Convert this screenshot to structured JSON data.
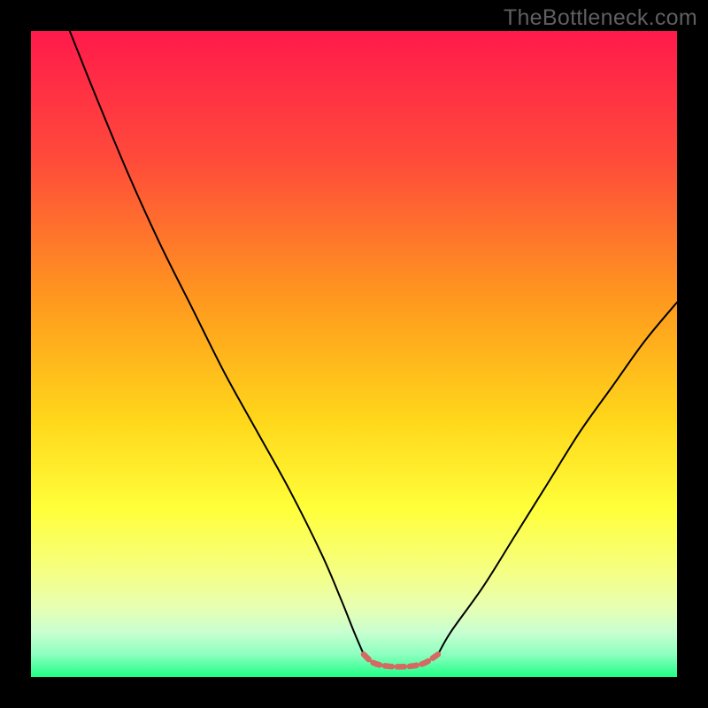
{
  "watermark": "TheBottleneck.com",
  "chart_data": {
    "type": "line",
    "title": "",
    "xlabel": "",
    "ylabel": "",
    "xlim": [
      0,
      100
    ],
    "ylim": [
      0,
      100
    ],
    "grid": false,
    "legend": false,
    "background_gradient_stops": [
      {
        "pct": 0,
        "color": "#ff1a4b"
      },
      {
        "pct": 20,
        "color": "#ff4b3a"
      },
      {
        "pct": 42,
        "color": "#ff9a1e"
      },
      {
        "pct": 60,
        "color": "#ffd61a"
      },
      {
        "pct": 74,
        "color": "#ffff3a"
      },
      {
        "pct": 83,
        "color": "#f6ff7d"
      },
      {
        "pct": 89,
        "color": "#e8ffb0"
      },
      {
        "pct": 93,
        "color": "#c9ffd0"
      },
      {
        "pct": 96.5,
        "color": "#8dffc0"
      },
      {
        "pct": 100,
        "color": "#1fff86"
      }
    ],
    "series": [
      {
        "name": "left-curve",
        "color": "#000000",
        "width": 2,
        "x": [
          6,
          10,
          15,
          20,
          25,
          30,
          35,
          40,
          45,
          48,
          50,
          51.5
        ],
        "y": [
          100,
          90,
          78,
          67,
          57,
          47,
          38,
          29,
          19,
          12,
          7,
          3.5
        ]
      },
      {
        "name": "right-curve",
        "color": "#000000",
        "width": 2,
        "x": [
          63,
          65,
          70,
          75,
          80,
          85,
          90,
          95,
          100
        ],
        "y": [
          3.5,
          7,
          14,
          22,
          30,
          38,
          45,
          52,
          58
        ]
      },
      {
        "name": "valley-highlight",
        "color": "#d56a63",
        "width": 6.5,
        "dasharray": "8 6",
        "x": [
          51.5,
          53,
          55,
          57,
          59,
          61,
          63
        ],
        "y": [
          3.5,
          2.2,
          1.7,
          1.6,
          1.7,
          2.2,
          3.5
        ]
      }
    ]
  }
}
